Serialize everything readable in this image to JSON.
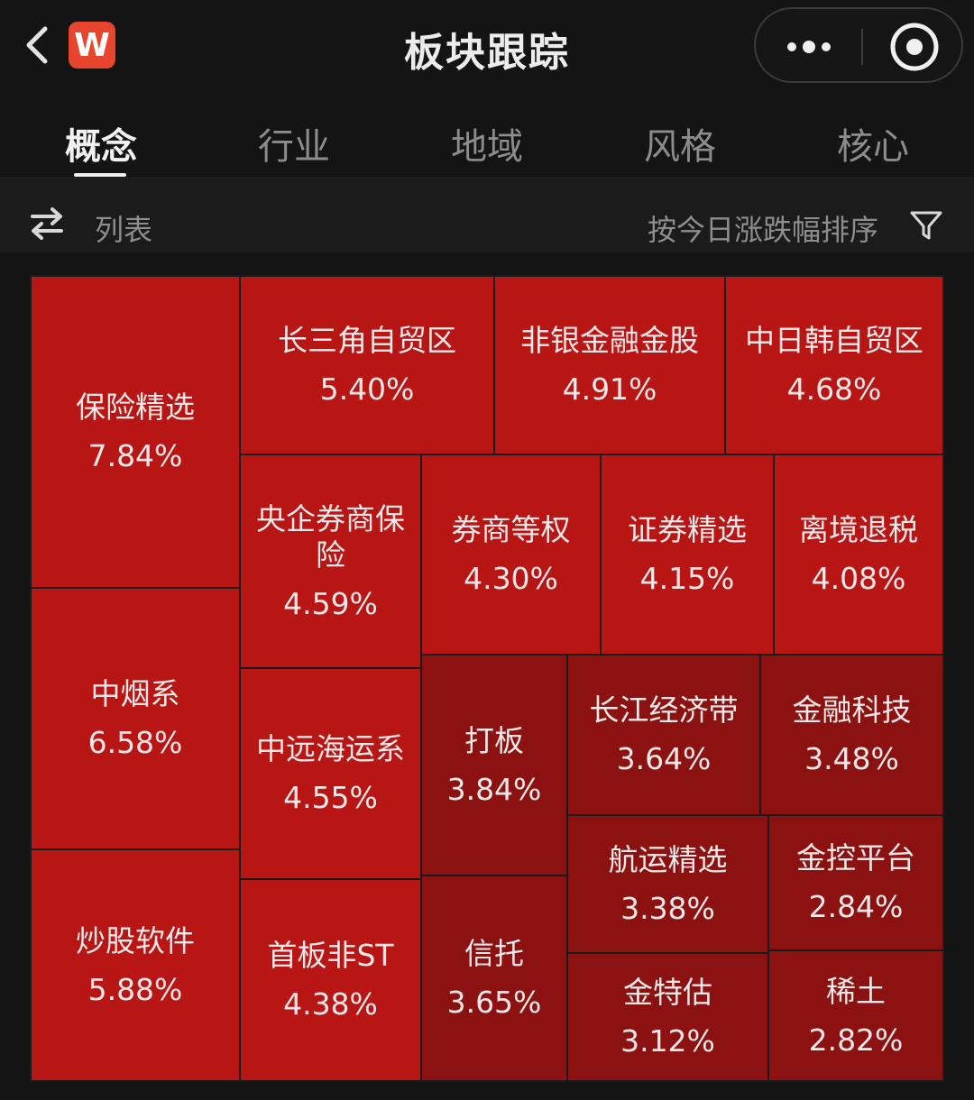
{
  "header": {
    "title": "板块跟踪",
    "logo_letter": "W",
    "back_icon": "chevron-left-icon",
    "more_icon": "more-dots-icon",
    "target_icon": "target-circle-icon"
  },
  "tabs": [
    {
      "label": "概念",
      "active": true
    },
    {
      "label": "行业",
      "active": false
    },
    {
      "label": "地域",
      "active": false
    },
    {
      "label": "风格",
      "active": false
    },
    {
      "label": "核心",
      "active": false
    }
  ],
  "toolbar": {
    "view_label": "列表",
    "sort_label": "按今日涨跌幅排序",
    "swap_icon": "swap-arrows-icon",
    "filter_icon": "filter-icon"
  },
  "colors": {
    "tile_bright": "#b81515",
    "tile_dark": "#8c1212",
    "logo": "#e8452f",
    "background": "#141414"
  },
  "sectors": [
    {
      "name": "保险精选",
      "change": "7.84%"
    },
    {
      "name": "中烟系",
      "change": "6.58%"
    },
    {
      "name": "炒股软件",
      "change": "5.88%"
    },
    {
      "name": "长三角自贸区",
      "change": "5.40%"
    },
    {
      "name": "非银金融金股",
      "change": "4.91%"
    },
    {
      "name": "中日韩自贸区",
      "change": "4.68%"
    },
    {
      "name": "央企券商保险",
      "change": "4.59%"
    },
    {
      "name": "中远海运系",
      "change": "4.55%"
    },
    {
      "name": "首板非ST",
      "change": "4.38%"
    },
    {
      "name": "券商等权",
      "change": "4.30%"
    },
    {
      "name": "证券精选",
      "change": "4.15%"
    },
    {
      "name": "离境退税",
      "change": "4.08%"
    },
    {
      "name": "打板",
      "change": "3.84%"
    },
    {
      "name": "信托",
      "change": "3.65%"
    },
    {
      "name": "长江经济带",
      "change": "3.64%"
    },
    {
      "name": "金融科技",
      "change": "3.48%"
    },
    {
      "name": "航运精选",
      "change": "3.38%"
    },
    {
      "name": "金控平台",
      "change": "2.84%"
    },
    {
      "name": "金特估",
      "change": "3.12%"
    },
    {
      "name": "稀土",
      "change": "2.82%"
    }
  ]
}
